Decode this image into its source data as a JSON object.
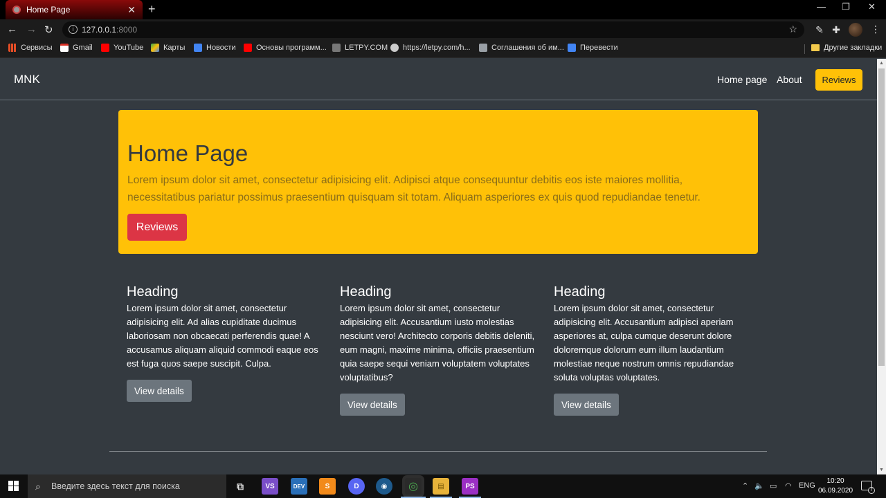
{
  "browser": {
    "tab_title": "Home Page",
    "tab_close": "✕",
    "new_tab": "+",
    "window_controls": [
      "—",
      "❐",
      "✕"
    ],
    "url_host": "127.0.0.1",
    "url_port": ":8000",
    "bookmarks": [
      {
        "label": "Сервисы",
        "icon": "apps-grid-icon",
        "color": "#e44d26"
      },
      {
        "label": "Gmail",
        "icon": "gmail-icon",
        "color": "#d93025"
      },
      {
        "label": "YouTube",
        "icon": "youtube-icon",
        "color": "#ff0000"
      },
      {
        "label": "Карты",
        "icon": "maps-icon",
        "color": "#34a853"
      },
      {
        "label": "Новости",
        "icon": "news-icon",
        "color": "#4285f4"
      },
      {
        "label": "Основы программ...",
        "icon": "youtube-icon",
        "color": "#ff0000"
      },
      {
        "label": "LETPY.COM",
        "icon": "letpy-icon",
        "color": "#777777"
      },
      {
        "label": "https://letpy.com/h...",
        "icon": "globe-icon",
        "color": "#cccccc"
      },
      {
        "label": "Соглашения об им...",
        "icon": "doc-icon",
        "color": "#9aa0a6"
      },
      {
        "label": "Перевести",
        "icon": "translate-icon",
        "color": "#4285f4"
      }
    ],
    "other_bookmarks": "Другие закладки"
  },
  "site": {
    "brand": "MNK",
    "nav": {
      "home": "Home page",
      "about": "About",
      "reviews": "Reviews"
    },
    "jumbotron": {
      "title": "Home Page",
      "text": "Lorem ipsum dolor sit amet, consectetur adipisicing elit. Adipisci atque consequuntur debitis eos iste maiores mollitia, necessitatibus pariatur possimus praesentium quisquam sit totam. Aliquam asperiores ex quis quod repudiandae tenetur.",
      "button": "Reviews"
    },
    "columns": [
      {
        "heading": "Heading",
        "text": "Lorem ipsum dolor sit amet, consectetur adipisicing elit. Ad alias cupiditate ducimus laboriosam non obcaecati perferendis quae! A accusamus aliquam aliquid commodi eaque eos est fuga quos saepe suscipit. Culpa.",
        "button": "View details"
      },
      {
        "heading": "Heading",
        "text": "Lorem ipsum dolor sit amet, consectetur adipisicing elit. Accusantium iusto molestias nesciunt vero! Architecto corporis debitis deleniti, eum magni, maxime minima, officiis praesentium quia saepe sequi veniam voluptatem voluptates voluptatibus?",
        "button": "View details"
      },
      {
        "heading": "Heading",
        "text": "Lorem ipsum dolor sit amet, consectetur adipisicing elit. Accusantium adipisci aperiam asperiores at, culpa cumque deserunt dolore doloremque dolorum eum illum laudantium molestiae neque nostrum omnis repudiandae soluta voluptas voluptates.",
        "button": "View details"
      }
    ],
    "colors": {
      "background": "#343a40",
      "warning": "#ffc107",
      "danger": "#dc3545",
      "secondary": "#6c757d"
    }
  },
  "taskbar": {
    "search_placeholder": "Введите здесь текст для поиска",
    "apps": [
      {
        "name": "task-view-icon",
        "label": "⧉",
        "color": "#101010"
      },
      {
        "name": "visual-studio-icon",
        "label": "VS",
        "color": "#7a4ec8"
      },
      {
        "name": "dev-icon",
        "label": "DEV",
        "color": "#2a6fb8"
      },
      {
        "name": "sublime-text-icon",
        "label": "S",
        "color": "#f28a1a"
      },
      {
        "name": "discord-icon",
        "label": "D",
        "color": "#5865f2"
      },
      {
        "name": "app-icon",
        "label": "◉",
        "color": "#1e5a8c"
      },
      {
        "name": "chrome-icon",
        "label": "◎",
        "color": "#2a2a2a"
      },
      {
        "name": "file-explorer-icon",
        "label": "▤",
        "color": "#e8b33a"
      },
      {
        "name": "phpstorm-icon",
        "label": "PS",
        "color": "#9b2fc4"
      }
    ],
    "language": "ENG",
    "time": "10:20",
    "date": "06.09.2020",
    "notifications": "7"
  }
}
